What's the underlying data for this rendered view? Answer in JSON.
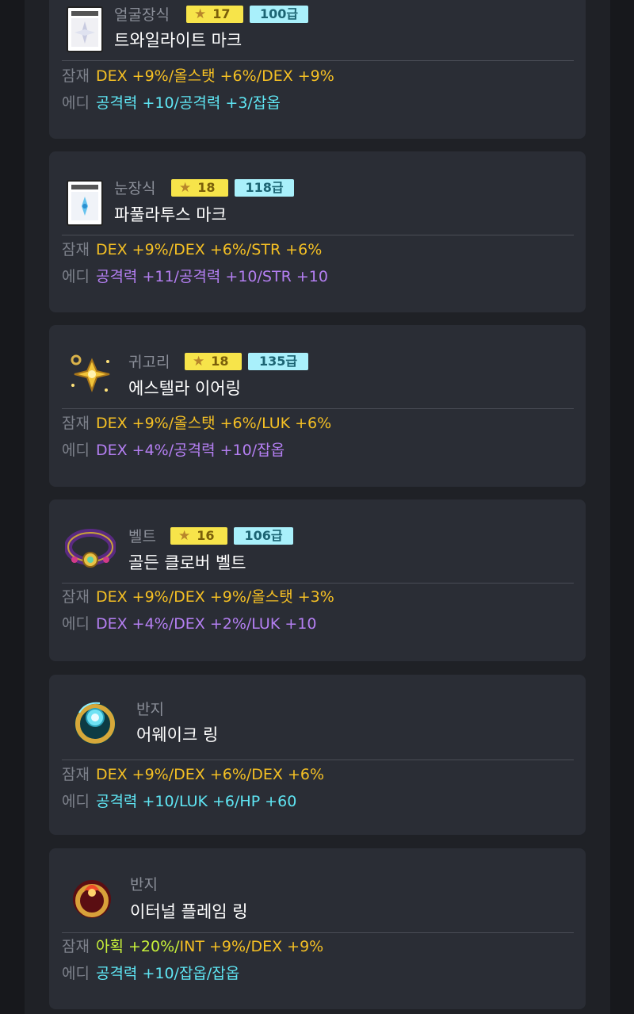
{
  "colors": {
    "background": "#17181c",
    "column": "#1f2126",
    "card": "#2a2d35",
    "star_badge": "#f7e44a",
    "level_badge": "#a9f0fb",
    "legendary_gold": "#f5c024",
    "additional_cyan": "#5fe6f4",
    "additional_purple": "#b47ff2",
    "bonus_lime": "#c8f23a"
  },
  "items": [
    {
      "slot": "얼굴장식",
      "stars": "17",
      "level": "100급",
      "name": "트와일라이트 마크",
      "icon": "face-accessory-icon",
      "potential_label": "잠재",
      "potential": "DEX +9%/올스탯 +6%/DEX +9%",
      "additional_label": "에디",
      "additional": "공격력 +10/공격력 +3/잡옵"
    },
    {
      "slot": "눈장식",
      "stars": "18",
      "level": "118급",
      "name": "파풀라투스 마크",
      "icon": "eye-accessory-icon",
      "potential_label": "잠재",
      "potential": "DEX +9%/DEX +6%/STR +6%",
      "additional_label": "에디",
      "additional": "공격력 +11/공격력 +10/STR +10"
    },
    {
      "slot": "귀고리",
      "stars": "18",
      "level": "135급",
      "name": "에스텔라 이어링",
      "icon": "earring-icon",
      "potential_label": "잠재",
      "potential": "DEX +9%/올스탯 +6%/LUK +6%",
      "additional_label": "에디",
      "additional": "DEX +4%/공격력 +10/잡옵"
    },
    {
      "slot": "벨트",
      "stars": "16",
      "level": "106급",
      "name": "골든 클로버 벨트",
      "icon": "belt-icon",
      "potential_label": "잠재",
      "potential": "DEX +9%/DEX +9%/올스탯 +3%",
      "additional_label": "에디",
      "additional": "DEX +4%/DEX +2%/LUK +10"
    },
    {
      "slot": "반지",
      "name": "어웨이크 링",
      "icon": "ring-icon",
      "potential_label": "잠재",
      "potential": "DEX +9%/DEX +6%/DEX +6%",
      "additional_label": "에디",
      "additional": "공격력 +10/LUK +6/HP +60"
    },
    {
      "slot": "반지",
      "name": "이터널 플레임 링",
      "icon": "flame-ring-icon",
      "potential_label": "잠재",
      "potential_prefix": "아획 +20%/",
      "potential": "INT +9%/DEX +9%",
      "additional_label": "에디",
      "additional": "공격력 +10/잡옵/잡옵"
    }
  ]
}
